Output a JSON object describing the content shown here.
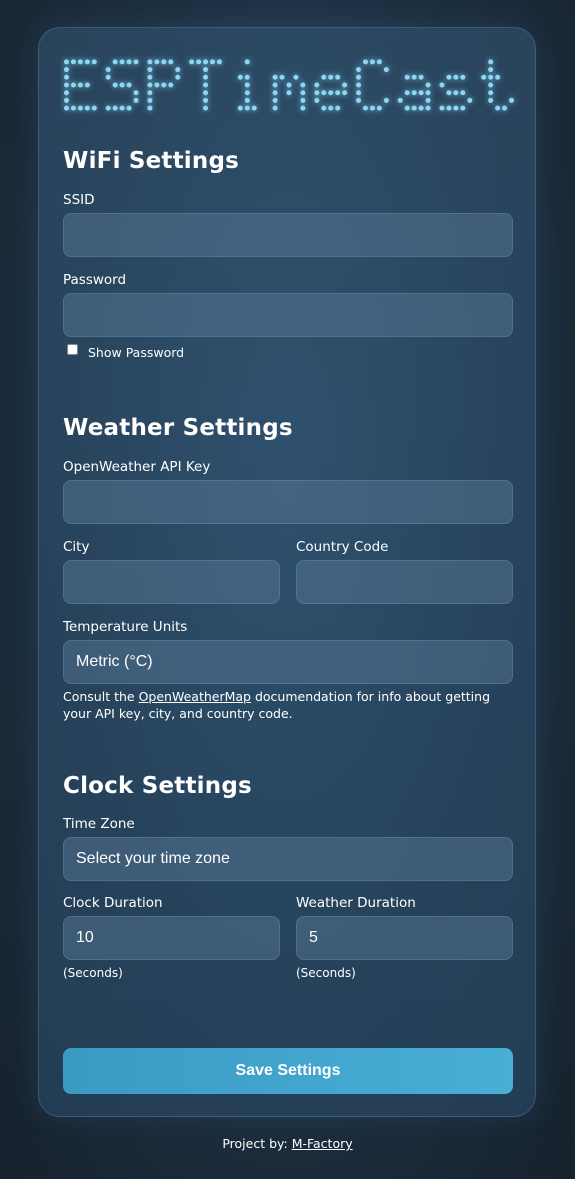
{
  "app": {
    "title": "ESPTimeCast"
  },
  "wifi": {
    "heading": "WiFi Settings",
    "ssid_label": "SSID",
    "ssid_value": "",
    "password_label": "Password",
    "password_value": "",
    "show_password_label": "Show Password",
    "show_password_checked": false
  },
  "weather": {
    "heading": "Weather Settings",
    "api_key_label": "OpenWeather API Key",
    "api_key_value": "",
    "city_label": "City",
    "city_value": "",
    "country_label": "Country Code",
    "country_value": "",
    "units_label": "Temperature Units",
    "units_value": "Metric (°C)",
    "note_prefix": "Consult the ",
    "note_link": "OpenWeatherMap",
    "note_suffix": " documendation for info about getting your API key, city, and country code."
  },
  "clock": {
    "heading": "Clock Settings",
    "tz_label": "Time Zone",
    "tz_value": "Select your time zone",
    "clock_duration_label": "Clock Duration",
    "clock_duration_value": "10",
    "clock_duration_unit": "(Seconds)",
    "weather_duration_label": "Weather Duration",
    "weather_duration_value": "5",
    "weather_duration_unit": "(Seconds)"
  },
  "actions": {
    "save_label": "Save Settings"
  },
  "footer": {
    "prefix": "Project by: ",
    "link": "M-Factory"
  },
  "colors": {
    "accent": "#45a8d2",
    "logo_dot": "#8fd6f0"
  }
}
